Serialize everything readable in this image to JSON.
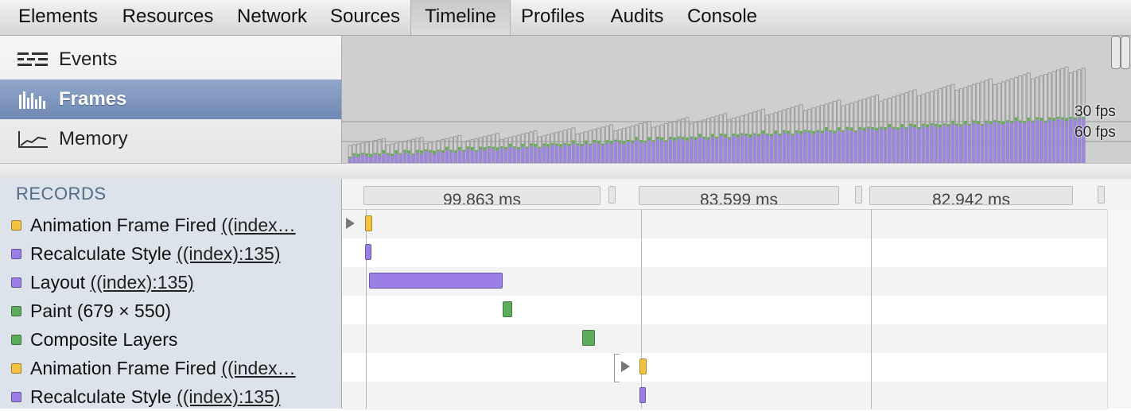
{
  "tabs": [
    {
      "label": "Elements",
      "selected": false
    },
    {
      "label": "Resources",
      "selected": false
    },
    {
      "label": "Network",
      "selected": false
    },
    {
      "label": "Sources",
      "selected": false
    },
    {
      "label": "Timeline",
      "selected": true
    },
    {
      "label": "Profiles",
      "selected": false
    },
    {
      "label": "Audits",
      "selected": false
    },
    {
      "label": "Console",
      "selected": false
    }
  ],
  "overview_modes": [
    {
      "label": "Events",
      "icon": "events-icon",
      "selected": false
    },
    {
      "label": "Frames",
      "icon": "frames-icon",
      "selected": true
    },
    {
      "label": "Memory",
      "icon": "memory-icon",
      "selected": false
    }
  ],
  "overview_graph": {
    "fps_30_label": "30 fps",
    "fps_60_label": "60 fps"
  },
  "records": {
    "header": "RECORDS",
    "rows": [
      {
        "type": "scripting",
        "name": "Animation Frame Fired",
        "detail": "((index…",
        "color": "#f3c242"
      },
      {
        "type": "rendering",
        "name": "Recalculate Style",
        "detail": "((index):135)",
        "color": "#9b7fe6"
      },
      {
        "type": "rendering",
        "name": "Layout",
        "detail": "((index):135)",
        "color": "#9b7fe6"
      },
      {
        "type": "painting",
        "name": "Paint (679 × 550)",
        "detail": "",
        "color": "#5cac5c"
      },
      {
        "type": "painting",
        "name": "Composite Layers",
        "detail": "",
        "color": "#5cac5c"
      },
      {
        "type": "scripting",
        "name": "Animation Frame Fired",
        "detail": "((index…",
        "color": "#f3c242"
      },
      {
        "type": "rendering",
        "name": "Recalculate Style",
        "detail": "((index):135)",
        "color": "#9b7fe6"
      }
    ]
  },
  "frame_durations": [
    "99.863 ms",
    "83.599 ms",
    "82.942 ms"
  ],
  "colors": {
    "scripting": "#f3c242",
    "rendering": "#9b7fe6",
    "painting": "#5cac5c",
    "selected_mode": "#7b93bd"
  }
}
